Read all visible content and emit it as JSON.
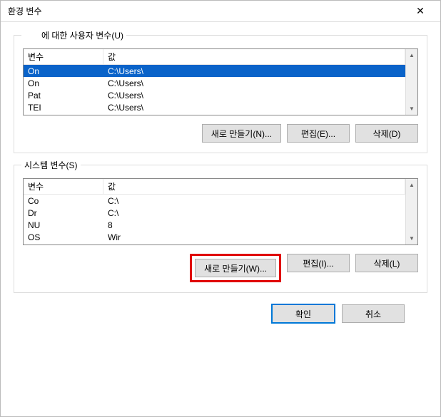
{
  "window": {
    "title": "환경 변수",
    "close_glyph": "✕"
  },
  "user_section": {
    "label": "에 대한 사용자 변수(U)",
    "header_variable": "변수",
    "header_value": "값",
    "rows": [
      {
        "name": "On",
        "value": "C:\\Users\\"
      },
      {
        "name": "On",
        "value": "C:\\Users\\"
      },
      {
        "name": "Pat",
        "value": "C:\\Users\\"
      },
      {
        "name": "TEI",
        "value": "C:\\Users\\"
      }
    ],
    "buttons": {
      "new": "새로 만들기(N)...",
      "edit": "편집(E)...",
      "delete": "삭제(D)"
    }
  },
  "system_section": {
    "label": "시스템 변수(S)",
    "header_variable": "변수",
    "header_value": "값",
    "rows": [
      {
        "name": "Co",
        "value": "C:\\"
      },
      {
        "name": "Dr",
        "value": "C:\\"
      },
      {
        "name": "NU",
        "value": "8"
      },
      {
        "name": "OS",
        "value": "Wir"
      }
    ],
    "buttons": {
      "new": "새로 만들기(W)...",
      "edit": "편집(I)...",
      "delete": "삭제(L)"
    }
  },
  "dialog": {
    "ok": "확인",
    "cancel": "취소"
  },
  "glyphs": {
    "up": "▲",
    "down": "▼"
  }
}
